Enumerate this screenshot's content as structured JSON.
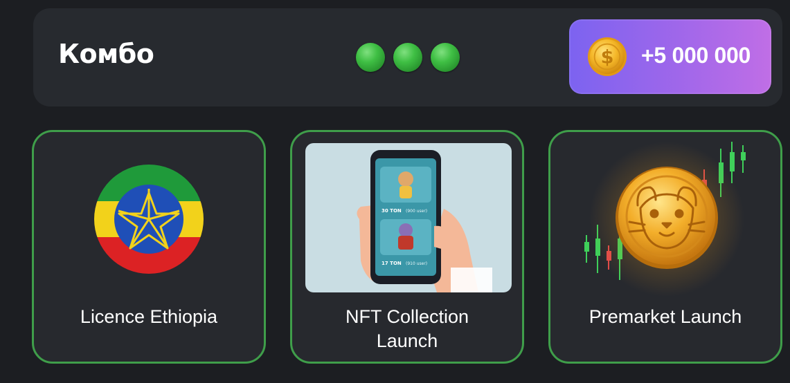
{
  "combo": {
    "title": "Комбо",
    "dots": 3,
    "reward": "+5 000 000"
  },
  "cards": [
    {
      "label": "Licence Ethiopia",
      "image": "ethiopia-flag-icon"
    },
    {
      "label": "NFT Collection Launch",
      "image": "phone-nft-image",
      "screen_items": [
        "30 TON",
        "(900 user)",
        "17 TON",
        "(910 user)"
      ]
    },
    {
      "label": "Premarket Launch",
      "image": "hamster-coin-chart-icon"
    }
  ],
  "colors": {
    "background": "#1c1e22",
    "panel": "#272a2f",
    "card_border": "#3f9e4a",
    "dot_green": "#3fbf44",
    "reward_gradient_start": "#7c63f0",
    "reward_gradient_end": "#c06ee6",
    "coin_gold": "#f5b82a"
  }
}
